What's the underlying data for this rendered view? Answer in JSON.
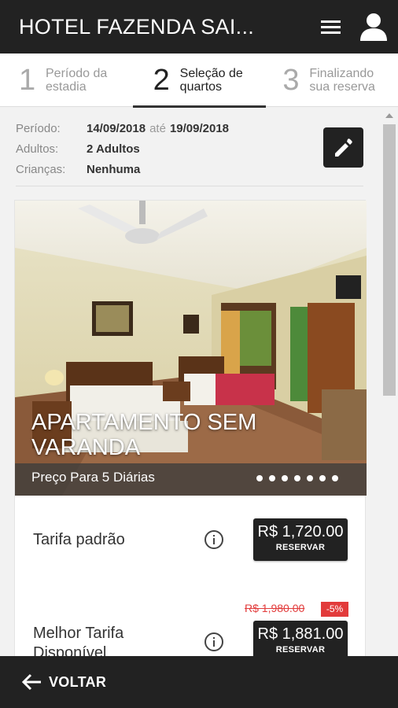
{
  "app": {
    "title": "HOTEL FAZENDA SAI...",
    "menu_icon": "menu-icon",
    "user_icon": "user-icon"
  },
  "steps": [
    {
      "number": "1",
      "label": "Período da\nestadia",
      "active": false
    },
    {
      "number": "2",
      "label": "Seleção de\nquartos",
      "active": true
    },
    {
      "number": "3",
      "label": "Finalizando\nsua reserva",
      "active": false
    }
  ],
  "summary": {
    "period_label": "Período:",
    "period_start": "14/09/2018",
    "period_sep": "até",
    "period_end": "19/09/2018",
    "adults_label": "Adultos:",
    "adults_value": "2 Adultos",
    "children_label": "Crianças:",
    "children_value": "Nenhuma",
    "edit_icon": "pencil-icon"
  },
  "room": {
    "name": "APARTAMENTO SEM VARANDA",
    "price_for": "Preço Para 5 Diárias",
    "photo_count": 7,
    "active_photo": 1
  },
  "rates": [
    {
      "name": "Tarifa padrão",
      "price": "R$ 1,720.00",
      "button_label": "RESERVAR"
    },
    {
      "name": "Melhor Tarifa Disponível",
      "old_price": "R$ 1,980.00",
      "discount": "-5%",
      "price": "R$ 1,881.00",
      "button_label": "RESERVAR"
    }
  ],
  "footer": {
    "back_label": "VOLTAR",
    "back_icon": "arrow-left-icon"
  },
  "colors": {
    "appbar": "#222222",
    "discount": "#e23b3b",
    "button": "#222222"
  }
}
